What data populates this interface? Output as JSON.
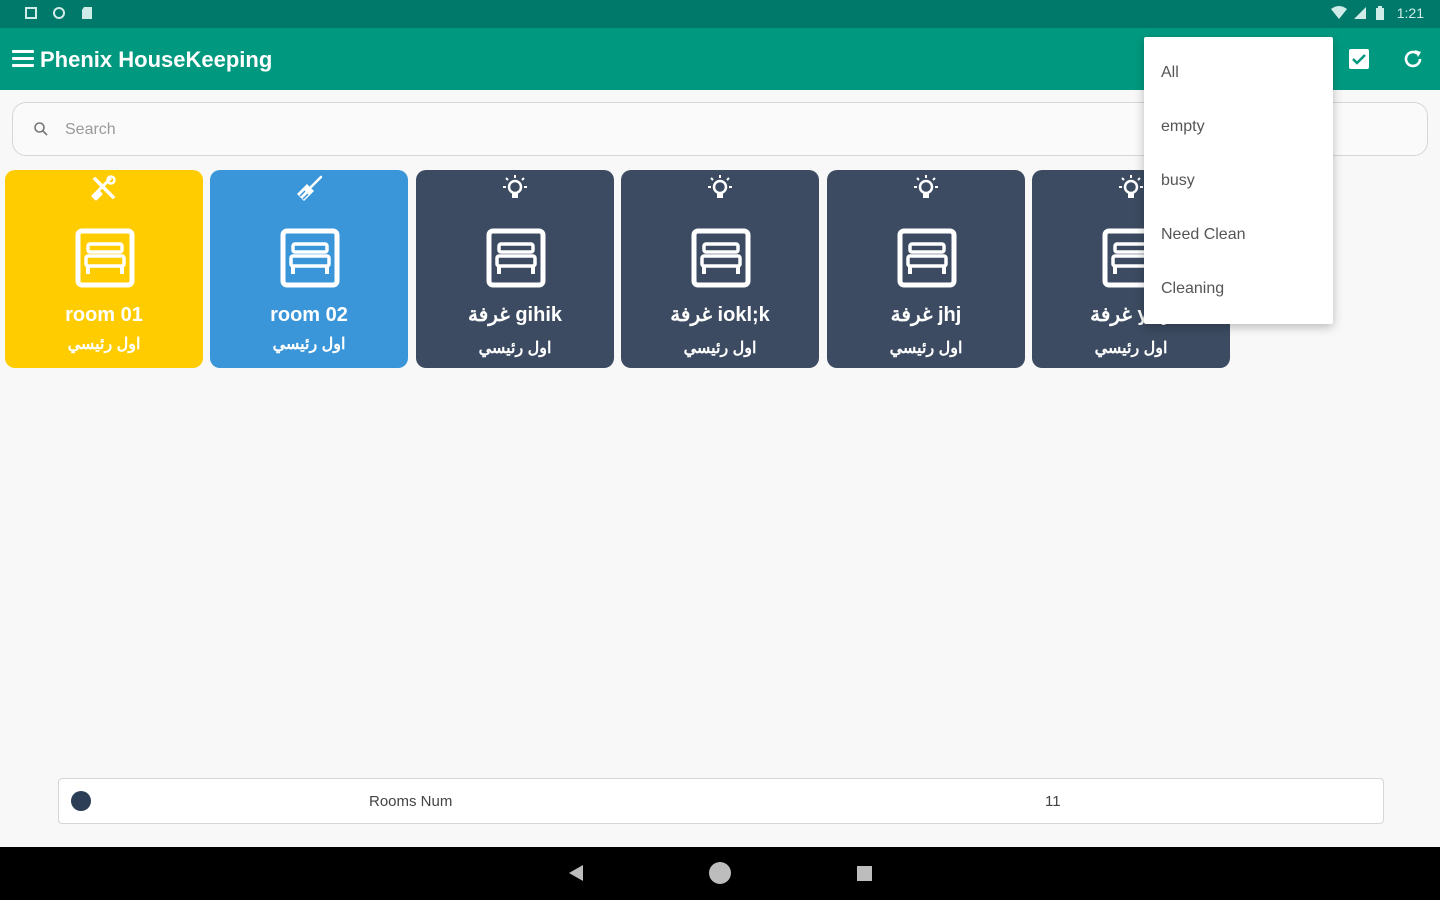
{
  "app": {
    "title": "Phenix HouseKeeping"
  },
  "status_bar": {
    "time": "1:21"
  },
  "search": {
    "placeholder": "Search"
  },
  "colors": {
    "app_bar": "#00997f",
    "status_bar": "#00796b",
    "maintenance": "#ffcc00",
    "cleaning": "#3a96d8",
    "idle": "#3c4b61"
  },
  "rooms": [
    {
      "name": "room 01",
      "type": "اول رئيسي",
      "status_icon": "tools-icon",
      "color": "#ffcc00"
    },
    {
      "name": "room 02",
      "type": "اول رئيسي",
      "status_icon": "broom-icon",
      "color": "#3a96d8"
    },
    {
      "name": "غرفة gihik",
      "type": "اول رئيسي",
      "status_icon": "bulb-icon",
      "color": "#3c4b61"
    },
    {
      "name": "غرفة iokl;k",
      "type": "اول رئيسي",
      "status_icon": "bulb-icon",
      "color": "#3c4b61"
    },
    {
      "name": "غرفة jhj",
      "type": "اول رئيسي",
      "status_icon": "bulb-icon",
      "color": "#3c4b61"
    },
    {
      "name": "غرفة yuy",
      "type": "اول رئيسي",
      "status_icon": "bulb-icon",
      "color": "#3c4b61"
    }
  ],
  "filter_menu": {
    "items": [
      "All",
      "empty",
      "busy",
      "Need Clean",
      "Cleaning"
    ]
  },
  "summary": {
    "label": "Rooms Num",
    "value": "11"
  }
}
